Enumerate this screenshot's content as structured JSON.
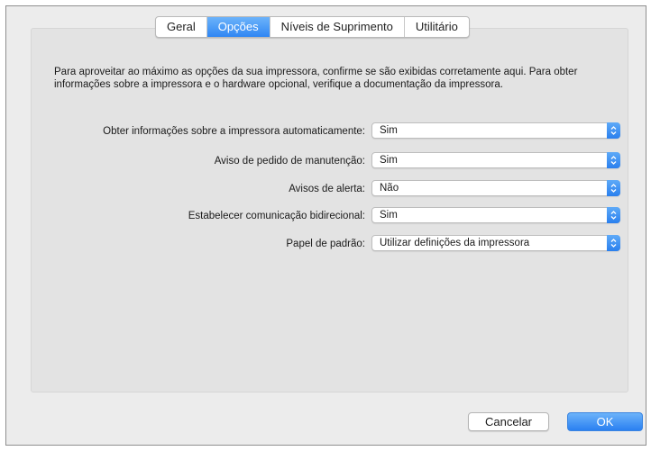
{
  "tabs": [
    {
      "label": "Geral",
      "active": false
    },
    {
      "label": "Opções",
      "active": true
    },
    {
      "label": "Níveis de Suprimento",
      "active": false
    },
    {
      "label": "Utilitário",
      "active": false
    }
  ],
  "description": "Para aproveitar ao máximo as opções da sua impressora, confirme se são exibidas corretamente aqui. Para obter informações sobre a impressora e o hardware opcional, verifique a documentação da impressora.",
  "settings": [
    {
      "label": "Obter informações sobre a impressora automaticamente:",
      "value": "Sim"
    },
    {
      "label": "Aviso de pedido de manutenção:",
      "value": "Sim"
    },
    {
      "label": "Avisos de alerta:",
      "value": "Não"
    },
    {
      "label": "Estabelecer comunicação bidirecional:",
      "value": "Sim"
    },
    {
      "label": "Papel de padrão:",
      "value": "Utilizar definições da impressora"
    }
  ],
  "buttons": {
    "cancel_label": "Cancelar",
    "ok_label": "OK"
  },
  "colors": {
    "accent": "#2f86f3",
    "panel": "#e3e3e3",
    "window": "#ececec"
  },
  "icons": {
    "select_stepper": "up-down-chevron-icon"
  }
}
